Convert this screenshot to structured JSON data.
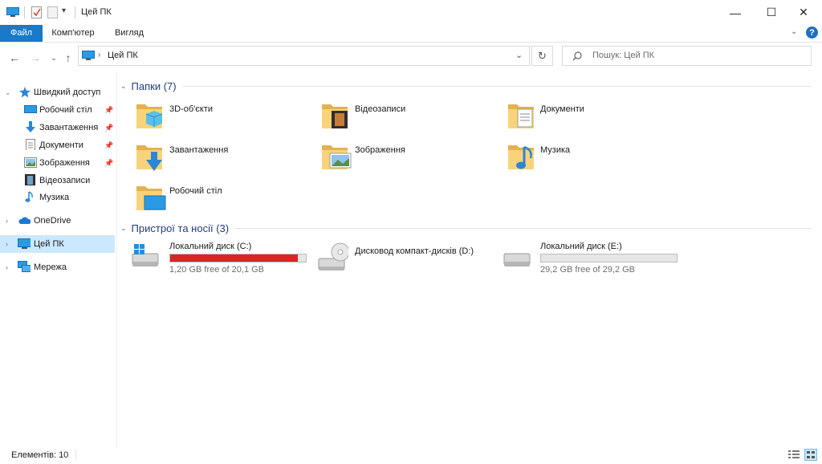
{
  "window": {
    "title": "Цей ПК",
    "controls": {
      "minimize": "—",
      "maximize": "☐",
      "close": "✕"
    }
  },
  "ribbon": {
    "tabs": [
      "Файл",
      "Комп'ютер",
      "Вигляд"
    ],
    "help_label": "?"
  },
  "address": {
    "path": "Цей ПК",
    "search_placeholder": "Пошук: Цей ПК"
  },
  "nav": {
    "quick_access": "Швидкий доступ",
    "quick_items": [
      "Робочий стіл",
      "Завантаження",
      "Документи",
      "Зображення",
      "Відеозаписи",
      "Музика"
    ],
    "onedrive": "OneDrive",
    "this_pc": "Цей ПК",
    "network": "Мережа"
  },
  "folders_group": {
    "header": "Папки (7)",
    "items": [
      "3D-об'єкти",
      "Відеозаписи",
      "Документи",
      "Завантаження",
      "Зображення",
      "Музика",
      "Робочий стіл"
    ]
  },
  "devices_group": {
    "header": "Пристрої та носії (3)",
    "drives": [
      {
        "name": "Локальний диск (C:)",
        "space": "1,20 GB free of 20,1 GB",
        "used_fraction": 0.94,
        "bar_color": "#da2626"
      },
      {
        "name": "Дисковод компакт-дисків (D:)"
      },
      {
        "name": "Локальний диск (E:)",
        "space": "29,2 GB free of 29,2 GB",
        "used_fraction": 0.0,
        "bar_color": "#26a0da"
      }
    ]
  },
  "status": {
    "items_count": "Елементів: 10"
  },
  "colors": {
    "accent": "#1979ca",
    "selection": "#cce8ff",
    "header_text": "#1f3d7a"
  }
}
